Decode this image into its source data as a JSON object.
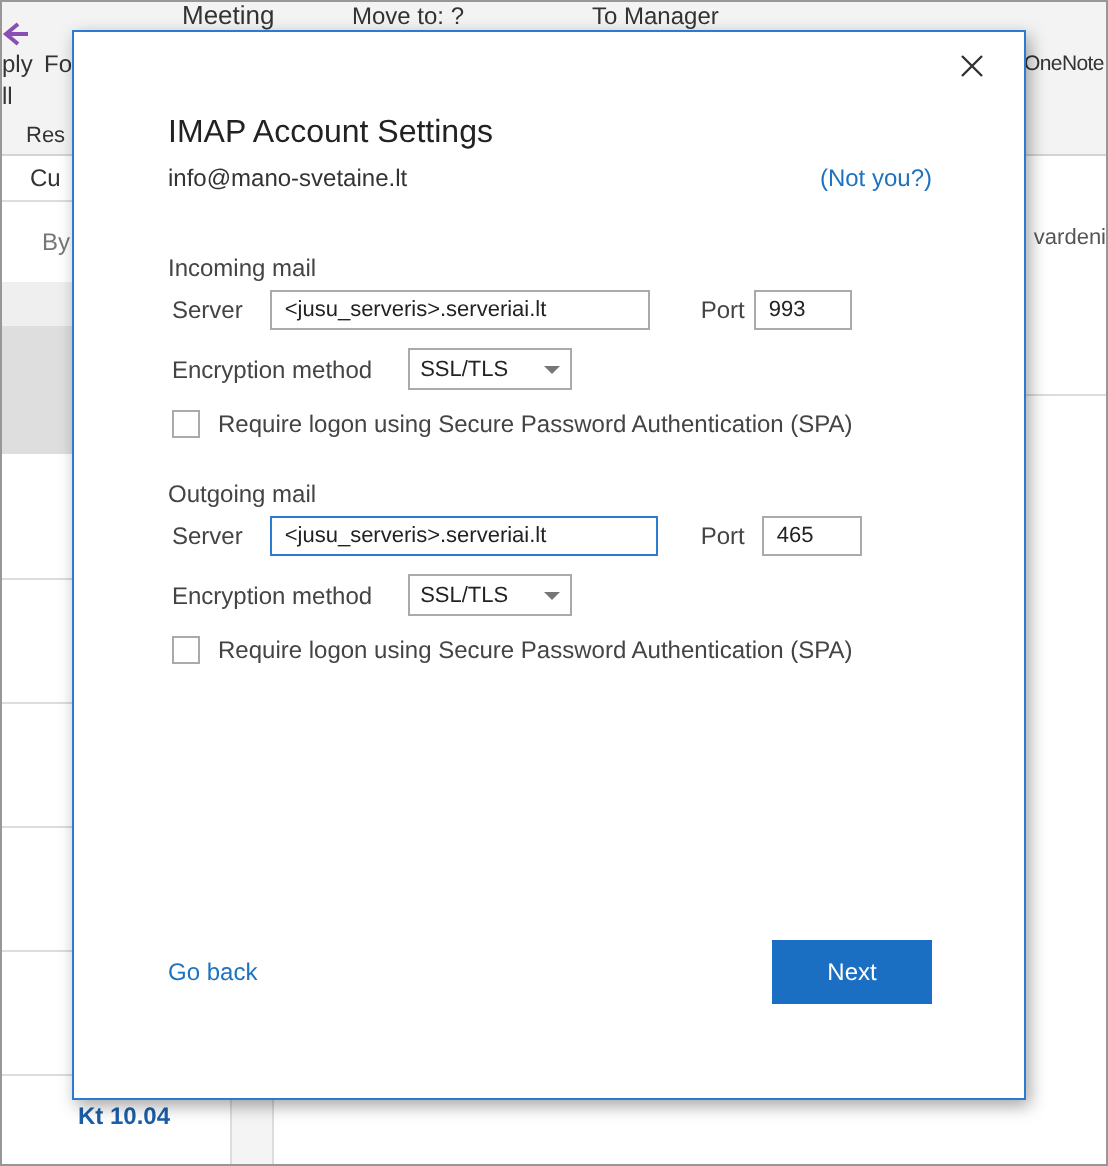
{
  "background": {
    "ribbon": {
      "reply_all": [
        "ply",
        "ll"
      ],
      "forward": "Fo",
      "meeting": "Meeting",
      "move_to": "Move to: ?",
      "to_manager": "To Manager",
      "onenote": "OneNote",
      "group_label": "Res"
    },
    "list": {
      "tab": "Cu",
      "filter": "By",
      "date": "Kt 10.04"
    },
    "reading_pane": {
      "text": "vardeni"
    }
  },
  "dialog": {
    "title": "IMAP Account Settings",
    "email": "info@mano-svetaine.lt",
    "not_you": "(Not you?)",
    "sections": [
      {
        "heading": "Incoming mail",
        "server_label": "Server",
        "server": "<jusu_serveris>.serveriai.lt",
        "focused": false,
        "port_label": "Port",
        "port": "993",
        "encryption_label": "Encryption method",
        "encryption": "SSL/TLS",
        "spa_label": "Require logon using Secure Password Authentication (SPA)",
        "spa_checked": false
      },
      {
        "heading": "Outgoing mail",
        "server_label": "Server",
        "server": "<jusu_serveris>.serveriai.lt",
        "focused": true,
        "port_label": "Port",
        "port": "465",
        "encryption_label": "Encryption method",
        "encryption": "SSL/TLS",
        "spa_label": "Require logon using Secure Password Authentication (SPA)",
        "spa_checked": false
      }
    ],
    "back": "Go back",
    "next": "Next"
  }
}
